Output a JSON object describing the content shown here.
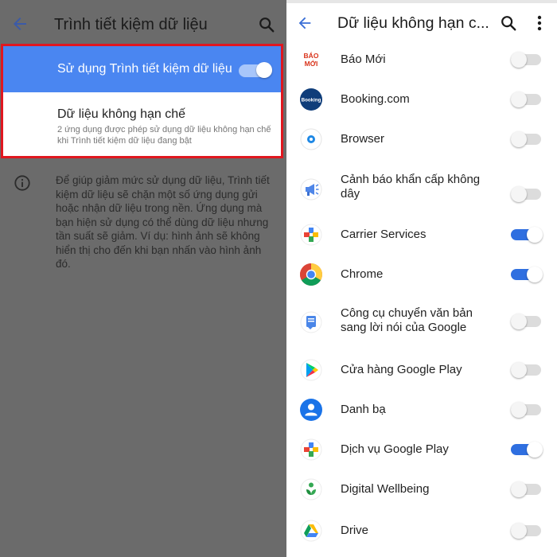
{
  "left": {
    "title": "Trình tiết kiệm dữ liệu",
    "saver_label": "Sử dụng Trình tiết kiệm dữ liệu",
    "saver_on": true,
    "unrestricted_title": "Dữ liệu không hạn chế",
    "unrestricted_desc": "2 ứng dụng được phép sử dụng dữ liệu không hạn chế khi Trình tiết kiệm dữ liệu đang bật",
    "info_text": "Để giúp giảm mức sử dụng dữ liệu, Trình tiết kiệm dữ liệu sẽ chặn một số ứng dụng gửi hoặc nhận dữ liệu trong nền. Ứng dụng mà bạn hiện sử dụng có thể dùng dữ liệu nhưng tần suất sẽ giảm. Ví dụ: hình ảnh sẽ không hiển thị cho đến khi bạn nhấn vào hình ảnh đó.",
    "colors": {
      "accent": "#4a86f1",
      "highlight": "#e0171f",
      "overlay": "#6b6b6b"
    }
  },
  "right": {
    "title": "Dữ liệu không hạn c...",
    "apps": [
      {
        "name": "Báo Mới",
        "icon": "baomoi-icon",
        "enabled": false
      },
      {
        "name": "Booking.com",
        "icon": "booking-icon",
        "enabled": false,
        "icon_text": "Booking"
      },
      {
        "name": "Browser",
        "icon": "browser-icon",
        "enabled": false
      },
      {
        "name": "Cảnh báo khẩn cấp không dây",
        "icon": "emergency-alert-icon",
        "enabled": false
      },
      {
        "name": "Carrier Services",
        "icon": "carrier-services-icon",
        "enabled": true
      },
      {
        "name": "Chrome",
        "icon": "chrome-icon",
        "enabled": true
      },
      {
        "name": "Công cụ chuyển văn bản sang lời nói của Google",
        "icon": "tts-icon",
        "enabled": false
      },
      {
        "name": "Cửa hàng Google Play",
        "icon": "play-store-icon",
        "enabled": false
      },
      {
        "name": "Danh bạ",
        "icon": "contacts-icon",
        "enabled": false
      },
      {
        "name": "Dịch vụ Google Play",
        "icon": "play-services-icon",
        "enabled": true
      },
      {
        "name": "Digital Wellbeing",
        "icon": "digital-wellbeing-icon",
        "enabled": false
      },
      {
        "name": "Drive",
        "icon": "drive-icon",
        "enabled": false
      }
    ],
    "colors": {
      "switch_on": "#2f6fe0"
    }
  }
}
